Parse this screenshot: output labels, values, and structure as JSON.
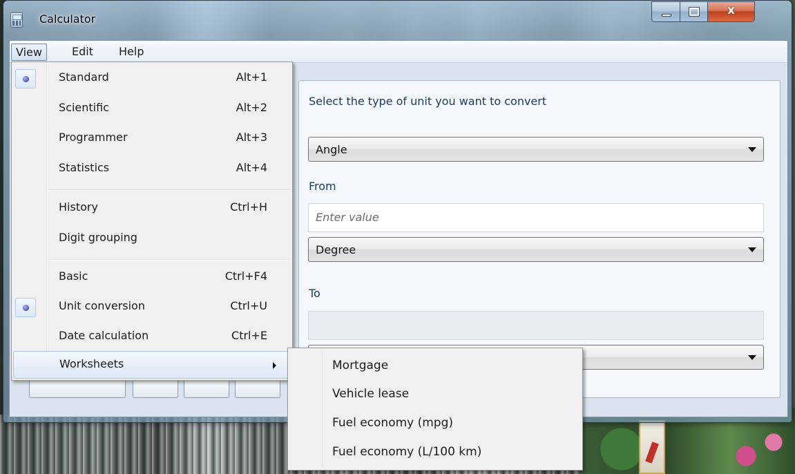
{
  "window": {
    "title": "Calculator",
    "close_glyph": "x"
  },
  "menubar": {
    "items": [
      {
        "label": "View",
        "active": true
      },
      {
        "label": "Edit"
      },
      {
        "label": "Help"
      }
    ]
  },
  "view_menu": {
    "items": [
      {
        "label": "Standard",
        "shortcut": "Alt+1",
        "checked": true
      },
      {
        "label": "Scientific",
        "shortcut": "Alt+2"
      },
      {
        "label": "Programmer",
        "shortcut": "Alt+3"
      },
      {
        "label": "Statistics",
        "shortcut": "Alt+4"
      },
      {
        "label": "History",
        "shortcut": "Ctrl+H"
      },
      {
        "label": "Digit grouping",
        "shortcut": ""
      },
      {
        "label": "Basic",
        "shortcut": "Ctrl+F4"
      },
      {
        "label": "Unit conversion",
        "shortcut": "Ctrl+U",
        "checked": true
      },
      {
        "label": "Date calculation",
        "shortcut": "Ctrl+E"
      },
      {
        "label": "Worksheets",
        "shortcut": "",
        "has_submenu": true,
        "highlighted": true
      }
    ]
  },
  "worksheets_menu": {
    "items": [
      "Mortgage",
      "Vehicle lease",
      "Fuel economy (mpg)",
      "Fuel economy (L/100 km)"
    ]
  },
  "converter": {
    "prompt": "Select the type of unit you want to convert",
    "type_selected": "Angle",
    "from_label": "From",
    "from_placeholder": "Enter value",
    "from_unit": "Degree",
    "to_label": "To",
    "to_value": "",
    "to_unit": ""
  },
  "icons": {
    "app": "calculator-icon",
    "minimize": "minimize-icon",
    "maximize": "maximize-icon",
    "close": "close-icon",
    "dropdown": "chevron-down-icon",
    "submenu": "chevron-right-icon",
    "radio": "radio-dot-icon"
  },
  "colors": {
    "menu_highlight": "#dde9f6",
    "close_button": "#c0411d",
    "label_text": "#1e3a5f"
  }
}
